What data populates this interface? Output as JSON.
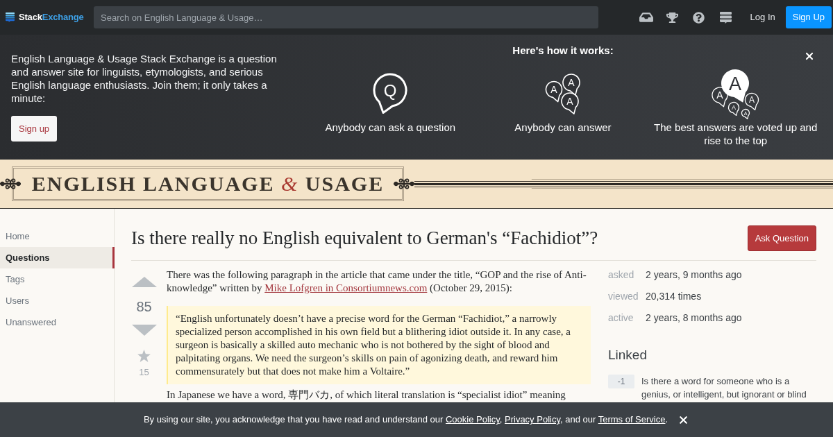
{
  "top_bar": {
    "logo": [
      "Stack",
      "Exchange"
    ],
    "search": {
      "placeholder": "Search on English Language & Usage…"
    },
    "login": "Log In",
    "signup": "Sign Up"
  },
  "hero": {
    "intro": "English Language & Usage Stack Exchange is a question and answer site for linguists, etymologists, and serious English language enthusiasts. Join them; it only takes a minute:",
    "signup_button": "Sign up",
    "heading": "Here's how it works:",
    "steps": [
      {
        "kind": "ask",
        "glyphs": [
          "Q"
        ],
        "caption": "Anybody can ask a question"
      },
      {
        "kind": "answer",
        "glyphs": [
          "A",
          "A",
          "A"
        ],
        "caption": "Anybody can answer"
      },
      {
        "kind": "vote",
        "glyphs": [
          "A",
          "A",
          "A",
          "A",
          "A"
        ],
        "caption": "The best answers are voted up and rise to the top"
      }
    ]
  },
  "banner": {
    "title": "ENGLISH LANGUAGE *&* USAGE"
  },
  "sidebar": {
    "items": [
      {
        "label": "Home",
        "selected": false
      },
      {
        "label": "Questions",
        "selected": true
      },
      {
        "label": "Tags",
        "selected": false
      },
      {
        "label": "Users",
        "selected": false
      },
      {
        "label": "Unanswered",
        "selected": false
      }
    ]
  },
  "question": {
    "title": "Is there really no English equivalent to German's “Fachidiot”?",
    "ask_button": "Ask Question",
    "votes": "85",
    "favorites": "15",
    "body": [
      {
        "kind": "paragraph",
        "segments": [
          {
            "kind": "text",
            "text": "There was the following paragraph in the article that came under the title, “GOP and the rise of Anti-knowledge” written by "
          },
          {
            "kind": "link",
            "text": "Mike Lofgren in Consortiumnews.com"
          },
          {
            "kind": "text",
            "text": " (October 29, 2015):"
          }
        ]
      },
      {
        "kind": "quote",
        "text": "“English unfortunately doesn’t have a precise word for the German “Fachidiot,” a narrowly specialized person accomplished in his own field but a blithering idiot outside it. In any case, a surgeon is basically a skilled auto mechanic who is not bothered by the sight of blood and palpitating organs. We need the surgeon’s skills on pain of agonizing death, and reward him commensurately but that does not make him a Voltaire.”"
      },
      {
        "kind": "paragraph",
        "segments": [
          {
            "kind": "text",
            "text": "In Japanese we have a word, 専門バカ, of which literal translation is “specialist idiot” meaning"
          }
        ]
      }
    ]
  },
  "stats": [
    {
      "label": "asked",
      "value": "2 years, 9 months ago"
    },
    {
      "label": "viewed",
      "value": "20,314 times"
    },
    {
      "label": "active",
      "value": "2 years, 8 months ago"
    }
  ],
  "linked": {
    "heading": "Linked",
    "items": [
      {
        "score": "-1",
        "title": "Is there a word for someone who is a genius, or intelligent, but ignorant or blind"
      }
    ]
  },
  "cookie_bar": {
    "segments": [
      {
        "kind": "text",
        "text": "By using our site, you acknowledge that you have read and understand our "
      },
      {
        "kind": "link",
        "text": "Cookie Policy"
      },
      {
        "kind": "text",
        "text": ", "
      },
      {
        "kind": "link",
        "text": "Privacy Policy"
      },
      {
        "kind": "text",
        "text": ", and our "
      },
      {
        "kind": "link",
        "text": "Terms of Service"
      },
      {
        "kind": "text",
        "text": "."
      }
    ]
  }
}
